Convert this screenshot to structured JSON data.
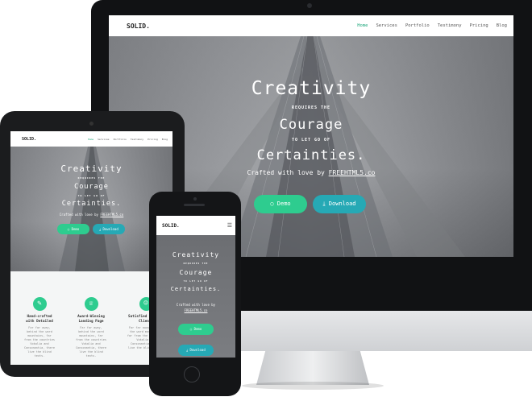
{
  "site": {
    "brand": "SOLID.",
    "nav": [
      "Home",
      "Services",
      "Portfolio",
      "Testimony",
      "Pricing",
      "Blog"
    ],
    "hero": {
      "line1": "Creativity",
      "line2": "REQUIRES THE",
      "line3": "Courage",
      "line4": "TO LET GO OF",
      "line5": "Certainties.",
      "crafted_prefix": "Crafted with love by",
      "crafted_link": "FREEHTML5.co"
    },
    "buttons": {
      "demo": "Demo",
      "download": "Download"
    },
    "features": [
      {
        "title": "Hand-crafted with Detailed",
        "text": "Far far away, behind the word mountains, far from the countries Vokalia and Consonantia, there live the blind texts."
      },
      {
        "title": "Award-Winning Landing Page",
        "text": "Far far away, behind the word mountains, far from the countries Vokalia and Consonantia, there live the blind texts."
      },
      {
        "title": "Satisfied & Happy Clients",
        "text": "Far far away, behind the word mountains, far from the countries Vokalia and Consonantia, there live the blind texts."
      }
    ]
  },
  "icons": {
    "demo": "circle-icon",
    "download": "download-icon",
    "menu": "hamburger-menu-icon",
    "feature_1": "pen-icon",
    "feature_2": "trophy-icon",
    "feature_3": "smile-icon"
  },
  "colors": {
    "accent_green": "#2ecc8f",
    "accent_teal": "#26a9b5",
    "nav_active": "#1aa67a",
    "device_dark": "#141517"
  }
}
